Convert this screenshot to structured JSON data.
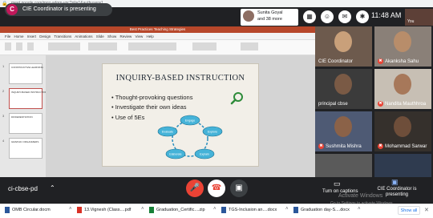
{
  "browser": {
    "url": "meet.google.com/mgz-adqm-vgc?pli=1&authuser=1"
  },
  "meet": {
    "presenter_initial": "C",
    "presenter_text": "CIE Coordinator is presenting",
    "notification": {
      "name": "Sunita Goyal",
      "sub": "and 38 more"
    },
    "clock": "11:48 AM",
    "self_label": "You",
    "meeting_code": "ci-cbse-pd",
    "captions_label": "Turn on captions",
    "present_label": "CIE Coordinator is presenting",
    "watermark_title": "Activate Windows",
    "watermark_sub": "Go to Settings to activate Windows."
  },
  "ppt": {
    "window_title": "Best Practices Teaching Strategies",
    "tabs": [
      "File",
      "Home",
      "Insert",
      "Design",
      "Transitions",
      "Animations",
      "Slide Show",
      "Review",
      "View",
      "Help"
    ],
    "thumbnails": [
      {
        "num": "1",
        "text": "CONSTRUCTIVE LEARNING"
      },
      {
        "num": "2",
        "text": "INQUIRY-BASED INSTRUCTION"
      },
      {
        "num": "3",
        "text": "DIFFERENTIATION"
      },
      {
        "num": "4",
        "text": "GRAPHIC ORGANIZERS"
      }
    ]
  },
  "slide": {
    "title": "INQUIRY-BASED INSTRUCTION",
    "bullets": [
      "Thought-provoking questions",
      "Investigate their own ideas",
      "Use of  5Es"
    ],
    "cycle": [
      "Engage",
      "Explore",
      "Explain",
      "Elaborate",
      "Evaluate"
    ]
  },
  "participants": [
    {
      "name": "CIE Coordinator",
      "muted": false,
      "bg": "#6d5a4d",
      "face": "#c9a07a"
    },
    {
      "name": "Akanksha Sahu",
      "muted": true,
      "bg": "#8a8078",
      "face": "#b88d6a"
    },
    {
      "name": "principal cbse",
      "muted": false,
      "bg": "#3b3b3b",
      "face": "#7a5a45"
    },
    {
      "name": "Nandita Mauthhroa",
      "muted": true,
      "bg": "#c7bfb4",
      "face": "#a7785a"
    },
    {
      "name": "Sushmita Mishra",
      "muted": true,
      "bg": "#4e5a74",
      "face": "#8b6248"
    },
    {
      "name": "Mohammad Sarwar",
      "muted": true,
      "bg": "#35302c",
      "face": "#6e4e3a"
    }
  ],
  "downloads": [
    {
      "name": "OMB Circular.docm",
      "color": "#2b579a"
    },
    {
      "name": "13.Vignesh (Class....pdf",
      "color": "#d93025"
    },
    {
      "name": "Graduation_Certific....zip",
      "color": "#188038"
    },
    {
      "name": "TGS-Inclusion an....docx",
      "color": "#2b579a"
    },
    {
      "name": "Graduation day-S....docx",
      "color": "#2b579a"
    }
  ],
  "downloads_show_all": "Show all",
  "colors": {
    "end_call": "#ea4335",
    "ppt_accent": "#b7472a",
    "meet_bg": "#202124"
  }
}
